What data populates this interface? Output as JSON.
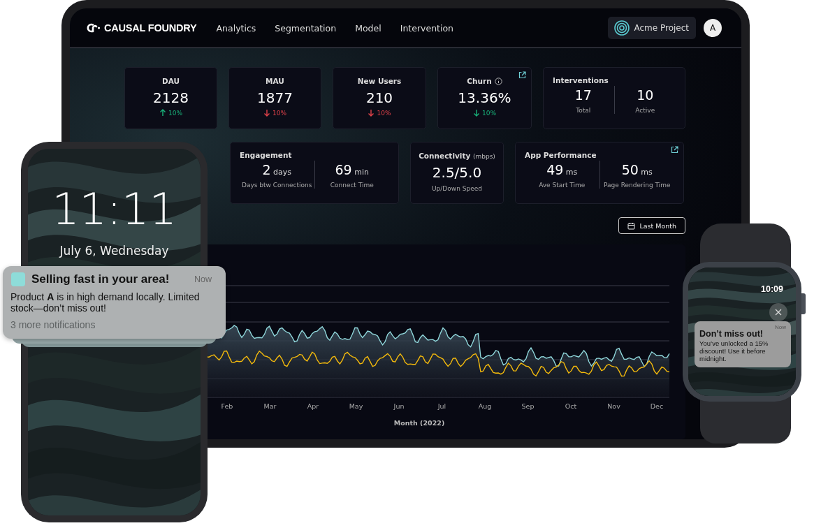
{
  "tablet": {
    "brand": "CAUSAL FOUNDRY",
    "nav": [
      {
        "label": "Analytics"
      },
      {
        "label": "Segmentation"
      },
      {
        "label": "Model"
      },
      {
        "label": "Intervention"
      }
    ],
    "project": "Acme Project",
    "avatar": "A",
    "metrics_top": [
      {
        "kind": "stat",
        "title": "DAU",
        "value": "2128",
        "change": "10%",
        "rising": true,
        "favorable": true
      },
      {
        "kind": "stat",
        "title": "MAU",
        "value": "1877",
        "change": "10%",
        "rising": false,
        "favorable": false
      },
      {
        "kind": "stat",
        "title": "New Users",
        "value": "210",
        "change": "10%",
        "rising": false,
        "favorable": false
      },
      {
        "kind": "stat",
        "title": "Churn",
        "value": "13.36%",
        "change": "10%",
        "rising": false,
        "favorable": true,
        "info": true,
        "external_link": true
      },
      {
        "kind": "split",
        "title": "Interventions",
        "items": [
          {
            "value": "17",
            "caption": "Total"
          },
          {
            "value": "10",
            "caption": "Active"
          }
        ]
      }
    ],
    "metrics_bottom": [
      {
        "kind": "split",
        "title": "Engagement",
        "items": [
          {
            "value": "2",
            "unit": "days",
            "caption": "Days btw Connections"
          },
          {
            "value": "69",
            "unit": "min",
            "caption": "Connect Time"
          }
        ]
      },
      {
        "kind": "single",
        "title": "Connectivity",
        "title_note": "(mbps)",
        "value": "2.5/5.0",
        "caption": "Up/Down Speed"
      },
      {
        "kind": "split",
        "title": "App Performance",
        "external_link": true,
        "items": [
          {
            "value": "49",
            "unit": "ms",
            "caption": "Ave Start Time"
          },
          {
            "value": "50",
            "unit": "ms",
            "caption": "Page Rendering Time"
          }
        ]
      }
    ],
    "date_button": "Last Month",
    "chart": {
      "months": [
        "Feb",
        "Mar",
        "Apr",
        "May",
        "Jun",
        "Jul",
        "Aug",
        "Sep",
        "Oct",
        "Nov",
        "Dec"
      ],
      "xlabel": "Month (2022)",
      "series": [
        {
          "color": "#8fd6da"
        },
        {
          "color": "#f3b90c"
        }
      ]
    }
  },
  "phone": {
    "time": "11:11",
    "date": "July 6, Wednesday",
    "notification": {
      "title": "Selling fast in your area!",
      "time": "Now",
      "body": "Product **A** is in high demand locally. Limited stock—don’t miss out!",
      "more": "3 more notifications"
    }
  },
  "watch": {
    "time": "10:09",
    "notification": {
      "time": "Now",
      "title": "Don’t miss out!",
      "body": "You’ve unlocked a 15% discount! Use it before midnight."
    }
  }
}
